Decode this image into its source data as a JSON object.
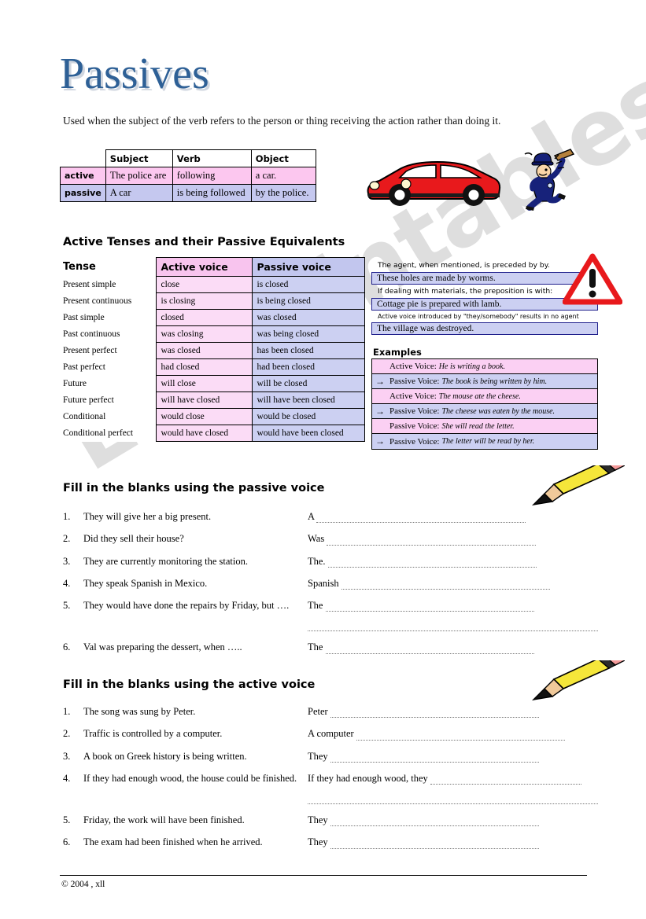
{
  "title": "Passives",
  "intro": "Used when the subject of the verb refers to the person or thing receiving the action rather than doing it.",
  "voice_table": {
    "headers": [
      "Subject",
      "Verb",
      "Object"
    ],
    "rows": [
      {
        "label": "active",
        "subject": "The police are",
        "verb": "following",
        "object": "a car."
      },
      {
        "label": "passive",
        "subject": "A car",
        "verb": "is being followed",
        "object": "by the police."
      }
    ]
  },
  "tenses_section": {
    "heading": "Active Tenses and their Passive Equivalents",
    "col_tense": "Tense",
    "col_active": "Active voice",
    "col_passive": "Passive voice",
    "rows": [
      {
        "tense": "Present simple",
        "active": "close",
        "passive": "is closed"
      },
      {
        "tense": "Present continuous",
        "active": "is closing",
        "passive": "is being closed"
      },
      {
        "tense": "Past simple",
        "active": "closed",
        "passive": "was closed"
      },
      {
        "tense": "Past continuous",
        "active": "was closing",
        "passive": "was being closed"
      },
      {
        "tense": "Present perfect",
        "active": "was closed",
        "passive": "has been closed"
      },
      {
        "tense": "Past perfect",
        "active": "had closed",
        "passive": "had been closed"
      },
      {
        "tense": "Future",
        "active": "will close",
        "passive": "will be closed"
      },
      {
        "tense": "Future perfect",
        "active": "will have closed",
        "passive": "will have been closed"
      },
      {
        "tense": "Conditional",
        "active": "would close",
        "passive": "would be closed"
      },
      {
        "tense": "Conditional perfect",
        "active": "would have closed",
        "passive": "would have been closed"
      }
    ]
  },
  "notes": {
    "line1": "The agent, when mentioned, is preceded by by.",
    "box1": "These holes are made by worms.",
    "line2": "If dealing with materials, the preposition is with:",
    "box2": "Cottage pie is prepared with lamb.",
    "line3": "Active voice introduced by \"they/somebody\" results in no agent",
    "box3": "The village was destroyed."
  },
  "examples": {
    "heading": "Examples",
    "rows": [
      {
        "arrow": "",
        "label": "Active Voice:",
        "sentence": "He is writing a book.",
        "tone": "pink"
      },
      {
        "arrow": "→",
        "label": "Passive Voice:",
        "sentence": "The book is being written by him.",
        "tone": "blue"
      },
      {
        "arrow": "",
        "label": "Active Voice:",
        "sentence": "The mouse ate the cheese.",
        "tone": "pink"
      },
      {
        "arrow": "→",
        "label": "Passive Voice:",
        "sentence": "The cheese was eaten by the mouse.",
        "tone": "blue"
      },
      {
        "arrow": "",
        "label": "Passive Voice:",
        "sentence": "She will read the letter.",
        "tone": "pink"
      },
      {
        "arrow": "→",
        "label": "Passive Voice:",
        "sentence": "The letter will be read by her.",
        "tone": "blue"
      }
    ]
  },
  "exercise_passive": {
    "heading": "Fill in the blanks using the passive voice",
    "items": [
      {
        "num": "1.",
        "prompt": "They will give her a big present.",
        "lead": "A",
        "extra_line": false,
        "justify": false
      },
      {
        "num": "2.",
        "prompt": "Did they sell their house?",
        "lead": "Was",
        "extra_line": false,
        "justify": false
      },
      {
        "num": "3.",
        "prompt": "They are currently monitoring the station.",
        "lead": "The.",
        "extra_line": false,
        "justify": false
      },
      {
        "num": "4.",
        "prompt": "They speak Spanish in Mexico.",
        "lead": "Spanish",
        "extra_line": false,
        "justify": false
      },
      {
        "num": "5.",
        "prompt": "They would have done the repairs by Friday, but ….",
        "lead": "The",
        "extra_line": true,
        "justify": true
      },
      {
        "num": "6.",
        "prompt": "Val was preparing the dessert, when  …..",
        "lead": "The",
        "extra_line": false,
        "justify": false
      }
    ]
  },
  "exercise_active": {
    "heading": "Fill in the blanks using the active voice",
    "items": [
      {
        "num": "1.",
        "prompt": "The song was sung by Peter.",
        "lead": "Peter",
        "extra_line": false,
        "justify": false
      },
      {
        "num": "2.",
        "prompt": "Traffic is controlled by a computer.",
        "lead": "A computer",
        "extra_line": false,
        "justify": false
      },
      {
        "num": "3.",
        "prompt": "A book on Greek history is being written.",
        "lead": "They",
        "extra_line": false,
        "justify": false
      },
      {
        "num": "4.",
        "prompt": "If they had enough wood, the house could be finished.",
        "lead": "If they had enough wood, they",
        "extra_line": true,
        "justify": true
      },
      {
        "num": "5.",
        "prompt": "Friday, the work will have been finished.",
        "lead": "They",
        "extra_line": false,
        "justify": false
      },
      {
        "num": "6.",
        "prompt": "The exam had been finished when he arrived.",
        "lead": "They",
        "extra_line": false,
        "justify": false
      }
    ]
  },
  "footer": "© 2004 , xll",
  "watermark": "ESLprintables.com",
  "colors": {
    "title_blue": "#2e6096",
    "pink_header": "#f8c4ee",
    "pink_cell": "#fbdcf6",
    "blue_header": "#c2c6ee",
    "blue_cell": "#ccd0f2",
    "warning_red": "#e8191c",
    "car_red": "#e8191c",
    "pencil_yellow": "#f5e63a"
  }
}
